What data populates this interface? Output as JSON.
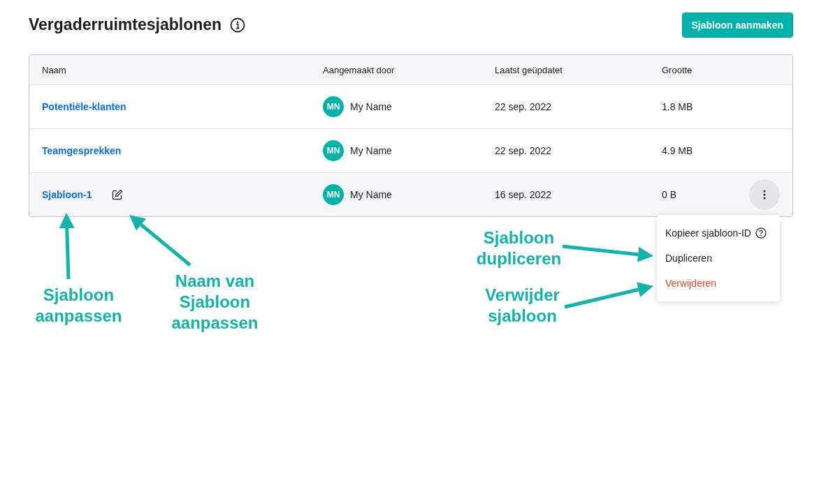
{
  "header": {
    "title": "Vergaderruimtesjablonen",
    "create_button": "Sjabloon aanmaken"
  },
  "table": {
    "columns": [
      "Naam",
      "Aangemaakt door",
      "Laatst geüpdatet",
      "Grootte"
    ],
    "rows": [
      {
        "name": "Potentiële-klanten",
        "initials": "MN",
        "creator": "My Name",
        "updated": "22 sep. 2022",
        "size": "1.8 MB",
        "selected": false
      },
      {
        "name": "Teamgesprekken",
        "initials": "MN",
        "creator": "My Name",
        "updated": "22 sep. 2022",
        "size": "4.9 MB",
        "selected": false
      },
      {
        "name": "Sjabloon-1",
        "initials": "MN",
        "creator": "My Name",
        "updated": "16 sep. 2022",
        "size": "0 B",
        "selected": true
      }
    ]
  },
  "menu": {
    "items": [
      {
        "label": "Kopieer sjabloon-ID",
        "kind": "help"
      },
      {
        "label": "Dupliceren",
        "kind": "plain"
      },
      {
        "label": "Verwijderen",
        "kind": "danger"
      }
    ]
  },
  "annotations": [
    "Sjabloon aanpassen",
    "Naam van Sjabloon aanpassen",
    "Sjabloon dupliceren",
    "Verwijder sjabloon"
  ]
}
